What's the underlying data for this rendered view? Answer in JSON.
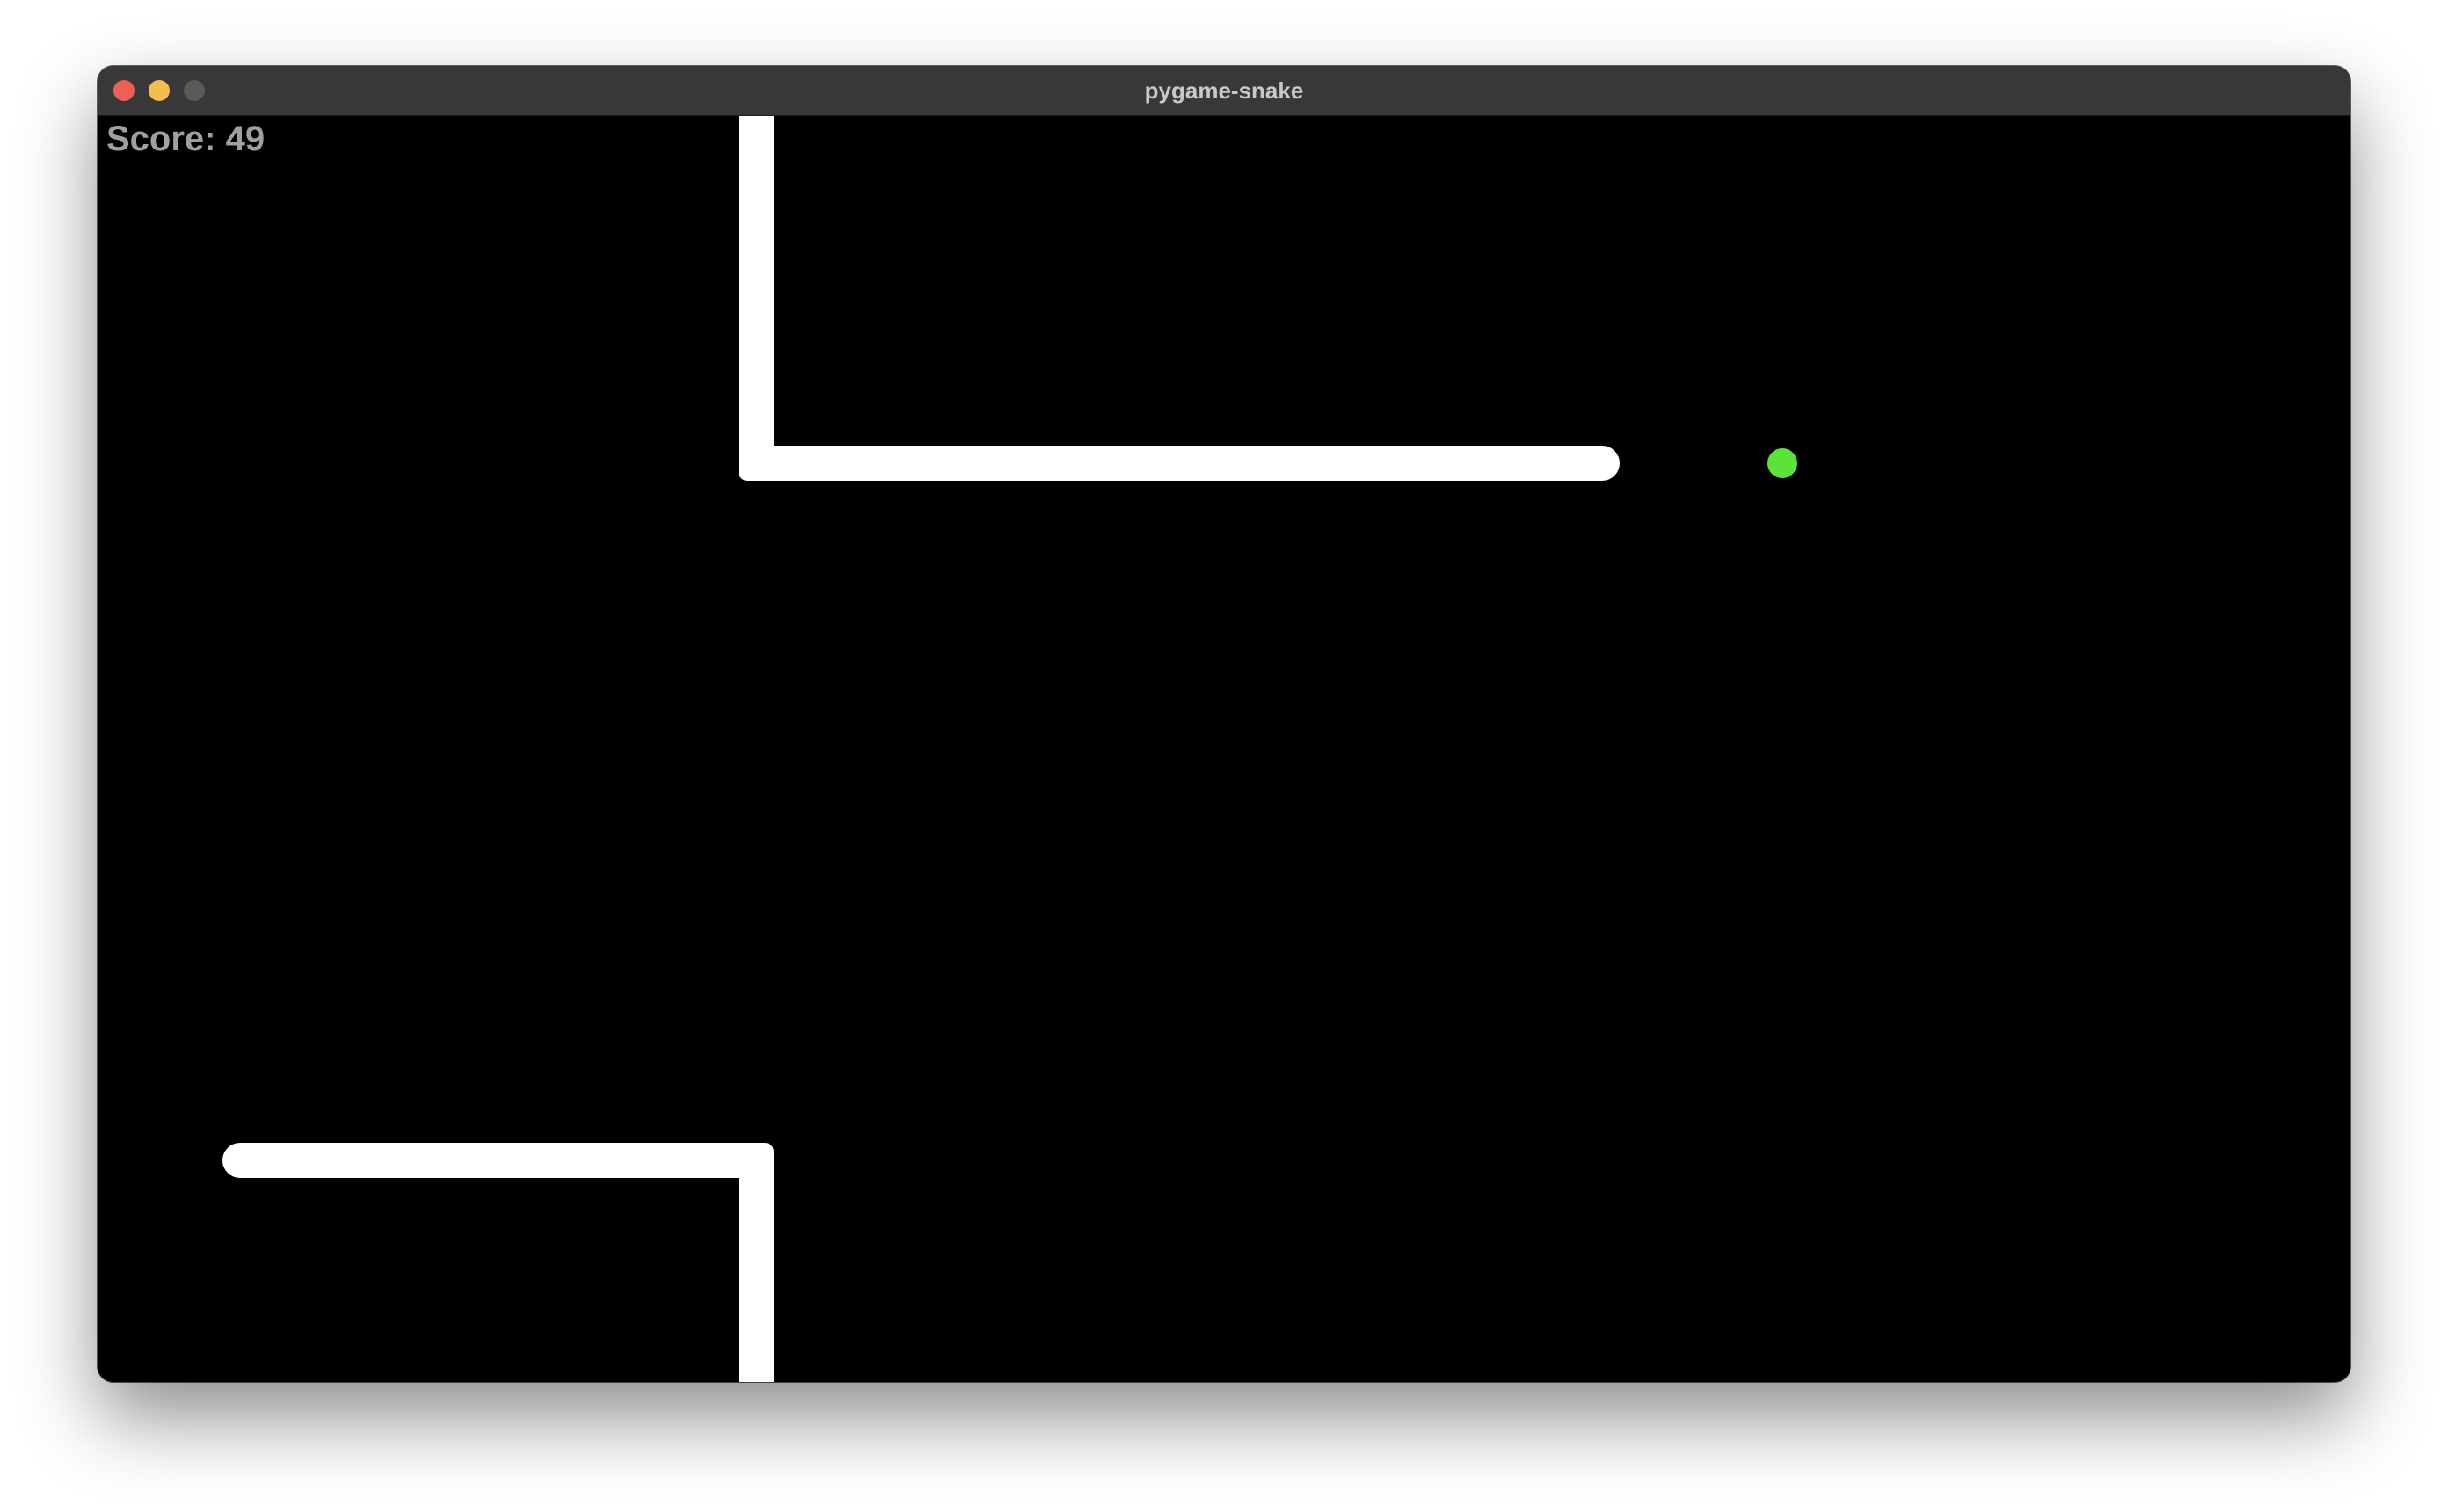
{
  "window": {
    "title": "pygame-snake",
    "controls": {
      "close_color": "#ee5f57",
      "minimize_color": "#f4bd4f",
      "zoom_color": "#5a5a5a"
    }
  },
  "game": {
    "score_text": "Score: 49",
    "background_color": "#000000",
    "snake_color": "#ffffff",
    "food_color": "#5be33a",
    "score_color": "#a0a0a0"
  }
}
